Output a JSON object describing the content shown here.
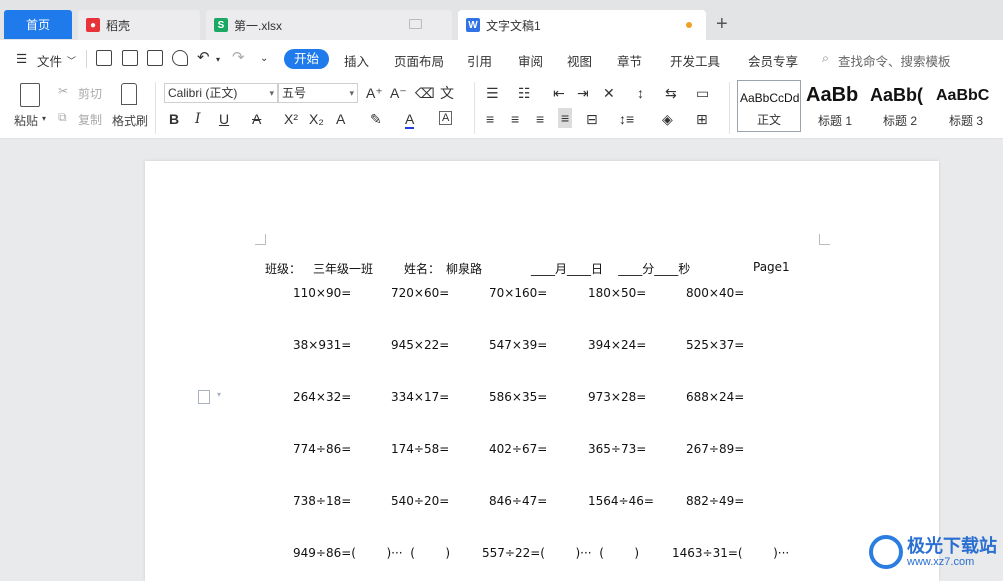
{
  "tabs": {
    "home": "首页",
    "t1": "稻壳",
    "t2": "第一.xlsx",
    "t3": "文字文稿1",
    "new_tab": "+"
  },
  "menu": {
    "file": "文件",
    "items": [
      "开始",
      "插入",
      "页面布局",
      "引用",
      "审阅",
      "视图",
      "章节",
      "开发工具",
      "会员专享"
    ],
    "search": "查找命令、搜索模板"
  },
  "ribbon": {
    "paste": "粘贴",
    "cut": "剪切",
    "copy": "复制",
    "format_painter": "格式刷",
    "font_name": "Calibri (正文)",
    "font_size": "五号",
    "styles": [
      {
        "sample": "AaBbCcDd",
        "caption": "正文"
      },
      {
        "sample": "AaBb",
        "caption": "标题 1"
      },
      {
        "sample": "AaBb(",
        "caption": "标题 2"
      },
      {
        "sample": "AaBbC",
        "caption": "标题 3"
      }
    ]
  },
  "document": {
    "header": {
      "class_label": "班级：",
      "class_value": "三年级一班",
      "name_label": "姓名：",
      "name_value": "柳泉路",
      "time": "____月____日    ____分____秒",
      "page": "Page1"
    },
    "rows": [
      [
        "110×90=",
        "720×60=",
        "70×160=",
        "180×50=",
        "800×40="
      ],
      [
        "38×931=",
        "945×22=",
        "547×39=",
        "394×24=",
        "525×37="
      ],
      [
        "264×32=",
        "334×17=",
        "586×35=",
        "973×28=",
        "688×24="
      ],
      [
        "774÷86=",
        "174÷58=",
        "402÷67=",
        "365÷73=",
        "267÷89="
      ],
      [
        "738÷18=",
        "540÷20=",
        "846÷47=",
        "1564÷46=",
        "882÷49="
      ]
    ],
    "last_row": [
      "949÷86=(        )···  (        )",
      "557÷22=(        )···  (        )",
      "1463÷31=(        )···"
    ]
  },
  "watermark": {
    "title": "极光下载站",
    "url": "www.xz7.com"
  }
}
